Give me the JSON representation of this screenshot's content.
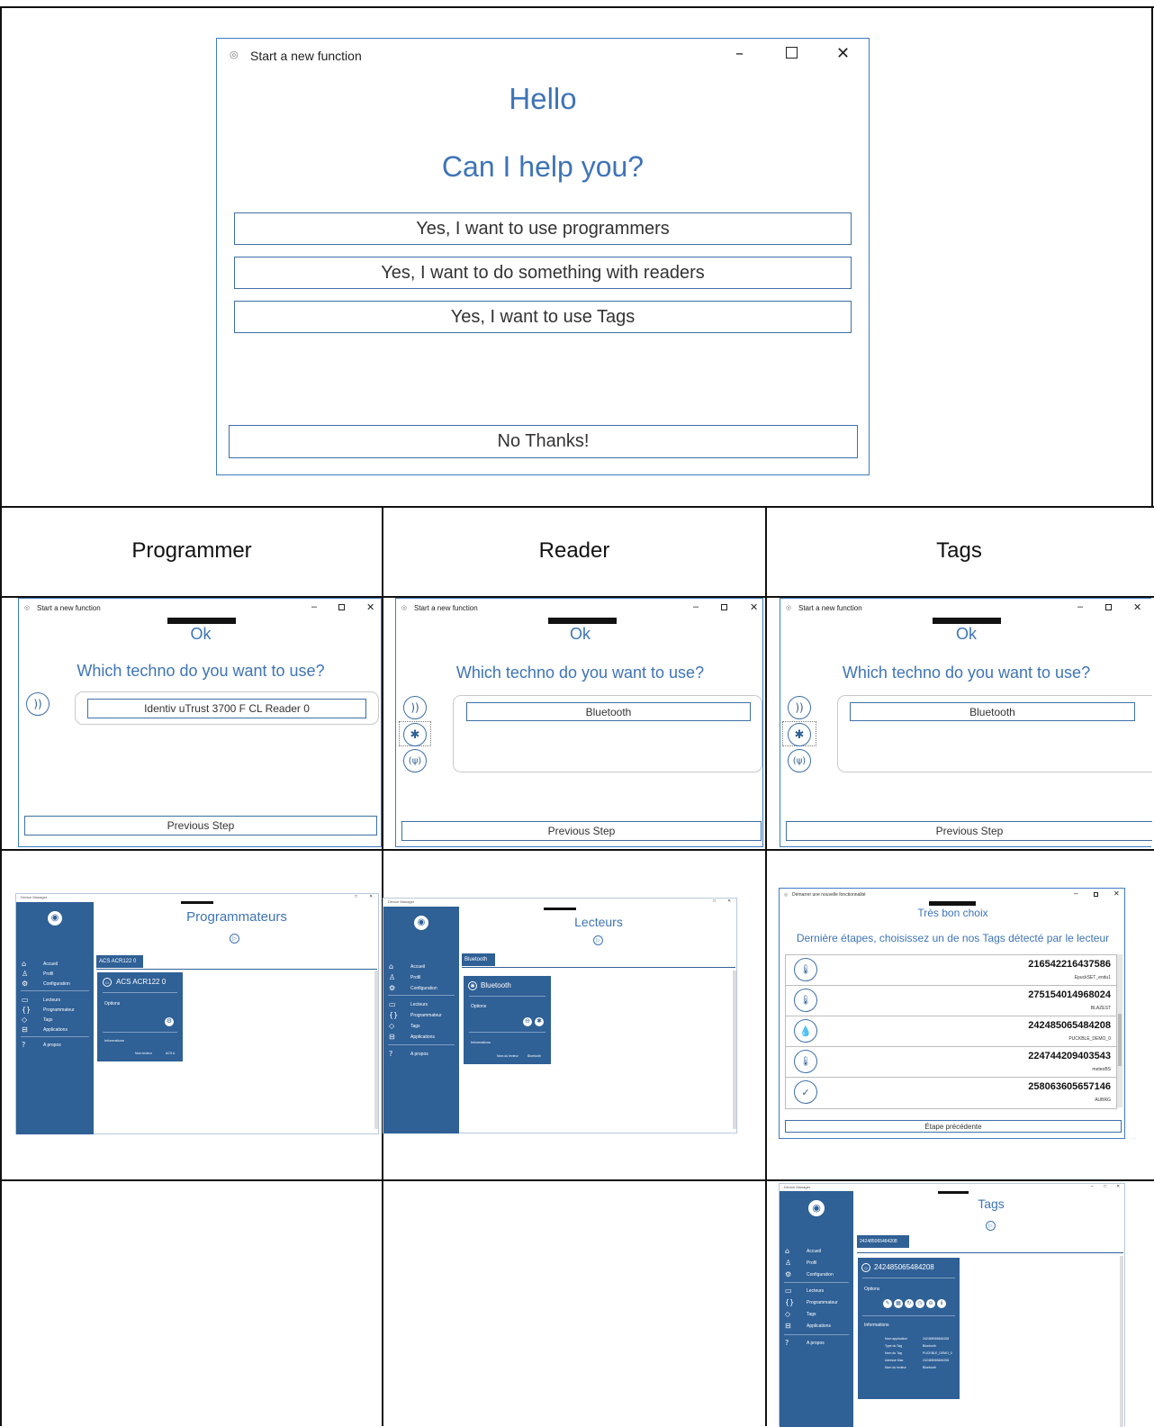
{
  "main_dialog": {
    "title": "Start a new function",
    "heading": "Hello",
    "question": "Can I help you?",
    "options": [
      "Yes, I want to use programmers",
      "Yes, I want to do something with readers",
      "Yes, I want to use Tags"
    ],
    "no_thanks": "No Thanks!"
  },
  "columns": [
    "Programmer",
    "Reader",
    "Tags"
  ],
  "step2": {
    "title": "Start a new function",
    "ok": "Ok",
    "question": "Which techno do you want to use?",
    "programmer_value": "Identiv uTrust 3700 F CL Reader 0",
    "reader_value": "Bluetooth",
    "tags_value": "Bluetooth",
    "previous": "Previous Step"
  },
  "programmer_app": {
    "title": "Device Manager",
    "heading": "Programmateurs",
    "tab": "ACS ACR122 0",
    "card_title": "ACS ACR122 0",
    "options_label": "Options",
    "info_label": "Informations",
    "info_key": "Nom lecteur",
    "info_val": "ACS A"
  },
  "reader_app": {
    "title": "Device Manager",
    "heading": "Lecteurs",
    "tab": "Bluetooth",
    "card_title": "Bluetooth",
    "options_label": "Options",
    "info_label": "Informations",
    "info_key": "Nom du lecteur",
    "info_val": "Bluetooth"
  },
  "sidebar": {
    "items": [
      "Accueil",
      "Profil",
      "Configuration",
      "Lecteurs",
      "Programmateur",
      "Tags",
      "Applications",
      "A propos"
    ]
  },
  "tags_dialog": {
    "title": "Démarrer une nouvelle fonctionnalité",
    "subtitle": "Très bon choix",
    "prompt": "Dernière étapes, choisissez un de nos Tags détecté par le lecteur",
    "tags": [
      {
        "id": "216542216437586",
        "name": "EpuckSET_endu1",
        "icon": "thermometer-icon"
      },
      {
        "id": "275154014968024",
        "name": "BLAZEST",
        "icon": "thermometer-icon"
      },
      {
        "id": "242485065484208",
        "name": "PUCKBLE_DEMO_0",
        "icon": "droplet-icon"
      },
      {
        "id": "224744209403543",
        "name": "meteoBS",
        "icon": "thermometer-icon"
      },
      {
        "id": "258063605657146",
        "name": "AUBRG",
        "icon": "check-icon"
      }
    ],
    "previous": "Étape précédente"
  },
  "tags_app": {
    "title": "Device Manager",
    "heading": "Tags",
    "tab": "242485065484208",
    "card_title": "242485065484208",
    "options_label": "Options",
    "info_label": "Informations",
    "info_rows": [
      {
        "k": "Nom application",
        "v": "242485065484208"
      },
      {
        "k": "Type du Tag",
        "v": "Bluetooth"
      },
      {
        "k": "Nom du Tag",
        "v": "PUCKBLE_DEMO_0"
      },
      {
        "k": "Adresse Mac",
        "v": "242485065484208"
      },
      {
        "k": "Nom du lecteur",
        "v": "Bluetooth"
      }
    ]
  }
}
